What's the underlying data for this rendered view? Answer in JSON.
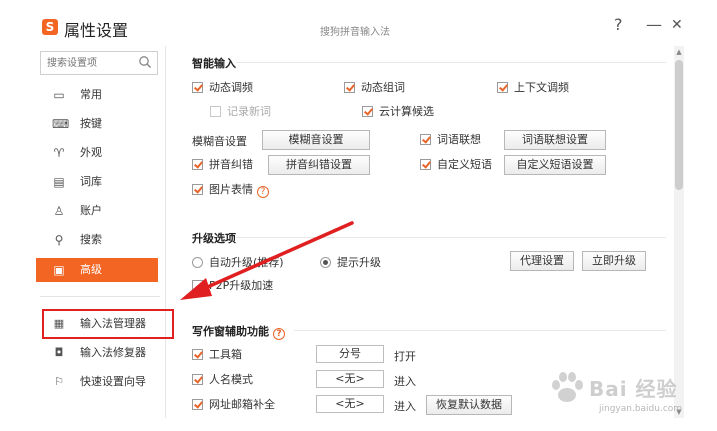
{
  "window": {
    "logo_char": "S",
    "title": "属性设置",
    "caption": "搜狗拼音输入法",
    "help": "?",
    "minimize": "—",
    "close": "✕"
  },
  "sidebar": {
    "search_placeholder": "搜索设置项",
    "items": [
      {
        "label": "常用",
        "icon": "monitor-icon"
      },
      {
        "label": "按键",
        "icon": "keyboard-icon"
      },
      {
        "label": "外观",
        "icon": "shirt-icon"
      },
      {
        "label": "词库",
        "icon": "book-icon"
      },
      {
        "label": "账户",
        "icon": "user-icon"
      },
      {
        "label": "搜索",
        "icon": "search-icon"
      },
      {
        "label": "高级",
        "icon": "advanced-icon",
        "active": true
      }
    ],
    "sub_items": [
      {
        "label": "输入法管理器",
        "icon": "manager-icon"
      },
      {
        "label": "输入法修复器",
        "icon": "repair-icon"
      },
      {
        "label": "快速设置向导",
        "icon": "flag-icon"
      }
    ]
  },
  "smart_input": {
    "title": "智能输入",
    "dynamic_freq": "动态调频",
    "dynamic_compose": "动态组词",
    "context_freq": "上下文调频",
    "record_new_words": "记录新词",
    "cloud_candidates": "云计算候选",
    "fuzzy_label": "模糊音设置",
    "fuzzy_button": "模糊音设置",
    "word_assoc": "词语联想",
    "word_assoc_button": "词语联想设置",
    "pinyin_correct": "拼音纠错",
    "pinyin_correct_button": "拼音纠错设置",
    "custom_phrase": "自定义短语",
    "custom_phrase_button": "自定义短语设置",
    "image_emoji": "图片表情"
  },
  "upgrade": {
    "title": "升级选项",
    "auto_upgrade": "自动升级(推荐)",
    "prompt_upgrade": "提示升级",
    "proxy_button": "代理设置",
    "upgrade_now_button": "立即升级",
    "p2p_label_a": "P2P",
    "p2p_label_b": "升级加速"
  },
  "writing": {
    "title": "写作窗辅助功能",
    "toolbox": "工具箱",
    "toolbox_key": "分号",
    "toolbox_action": "打开",
    "name_mode": "人名模式",
    "name_mode_key": "<无>",
    "name_mode_action": "进入",
    "url_email": "网址邮箱补全",
    "url_email_key": "<无>",
    "url_email_action": "进入",
    "restore_defaults": "恢复默认数据"
  },
  "watermark": {
    "brand": "Bai 经验",
    "url": "jingyan.baidu.com"
  },
  "colors": {
    "accent": "#f26522",
    "annotation_red": "#e02020"
  }
}
